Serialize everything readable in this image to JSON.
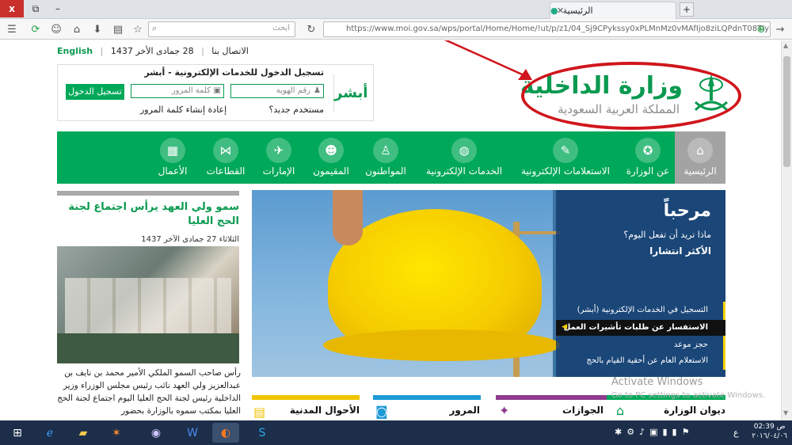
{
  "browser": {
    "tab_title": "الرئيسية",
    "close_label": "x",
    "url_full": "https://www.moi.gov.sa/wps/portal/Home/Home/!ut/p/z1/04_Sj9CPykssy0xPLMnMz0vMAfIjo8ziLQPdnT08TIy83Q0dzQwcPc2N_A08",
    "search_placeholder": "ابحث"
  },
  "header": {
    "lang_link": "English",
    "contact_link": "الاتصال بنا",
    "date": "28 جمادى الأخر 1437",
    "logo_title": "وزارة الداخلية",
    "logo_subtitle": "المملكة العربية السعودية"
  },
  "login": {
    "title": "تسجيل الدخول للخدمات الإلكترونية - أبشر",
    "id_placeholder": "رقم الهوية",
    "password_placeholder": "كلمة المرور",
    "submit_label": "تسجيل الدخول",
    "new_user": "مستخدم جديد؟",
    "reset_password": "إعادة إنشاء كلمة المرور",
    "absher_logo": "أبشر"
  },
  "nav": {
    "items": [
      {
        "label": "الرئيسية",
        "icon": "home-icon"
      },
      {
        "label": "عن الوزارة",
        "icon": "emblem-icon"
      },
      {
        "label": "الاستعلامات الإلكترونية",
        "icon": "inquiry-icon"
      },
      {
        "label": "الخدمات الإلكترونية",
        "icon": "globe-icon"
      },
      {
        "label": "المواطنون",
        "icon": "citizen-icon"
      },
      {
        "label": "المقيمون",
        "icon": "residents-icon"
      },
      {
        "label": "الإمارات",
        "icon": "map-icon"
      },
      {
        "label": "القطاعات",
        "icon": "sectors-icon"
      },
      {
        "label": "الأعمال",
        "icon": "briefcase-icon"
      }
    ]
  },
  "hero": {
    "title": "مرحباً",
    "subtitle": "ماذا تريد أن تفعل اليوم؟",
    "popular": "الأكثر انتشارا",
    "links": [
      "التسجيل في الخدمات الإلكترونية (أبشر)",
      "الاستفسار عن طلبات تأشيرات العمل",
      "حجز موعد",
      "الاستعلام العام عن أحقية القيام بالحج"
    ]
  },
  "news": {
    "title": "سمو ولي العهد يرأس اجتماع لجنة الحج العليا",
    "date": "الثلاثاء 27 جمادى الآخر 1437",
    "body": "رأس صاحب السمو الملكي الأمير محمد بن نايف بن عبدالعزيز ولي العهد نائب رئيس مجلس الوزراء وزير الداخلية رئيس لجنة الحج العليا اليوم اجتماع لجنة الحج العليا بمكتب سموه بالوزارة بحضور"
  },
  "cards": [
    {
      "label": "ديوان الوزارة",
      "color": "#00a859"
    },
    {
      "label": "الجوازات",
      "color": "#8e3b8f"
    },
    {
      "label": "المرور",
      "color": "#1e9ad6"
    },
    {
      "label": "الأحوال المدنية",
      "color": "#f0c400"
    }
  ],
  "watermark": {
    "line1": "Activate Windows",
    "line2": "Go to PC settings to activate Windows."
  },
  "taskbar": {
    "time": "02:39 ص",
    "date": "٢٠١٦/٠٤/٠٦",
    "lang": "ع"
  },
  "colors": {
    "brand_green": "#00a859",
    "annotation_red": "#d0161c",
    "taskbar": "#1c2e4a"
  }
}
